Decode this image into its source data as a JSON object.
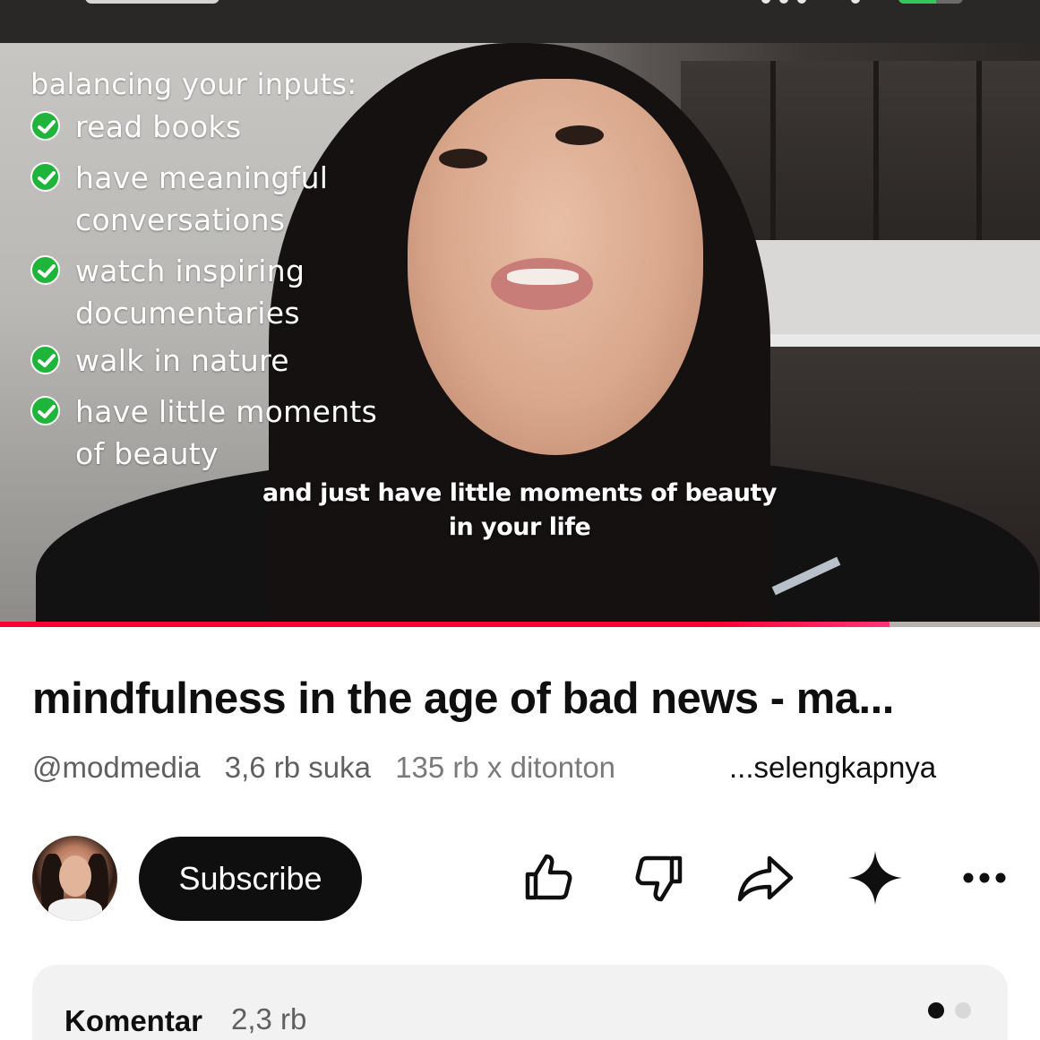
{
  "video": {
    "overlay_heading": "balancing your inputs:",
    "overlay_items": [
      [
        "read books"
      ],
      [
        "have meaningful",
        "conversations"
      ],
      [
        "watch inspiring",
        "documentaries"
      ],
      [
        "walk in nature"
      ],
      [
        "have little moments",
        "of beauty"
      ]
    ],
    "caption_line1": "and just have little moments of beauty",
    "caption_line2": "in your life",
    "progress_fraction": 0.855
  },
  "details": {
    "title": "mindfulness in the age of bad news - ma...",
    "handle": "@modmedia",
    "likes": "3,6 rb suka",
    "views": "135 rb x ditonton",
    "more_label": "...selengkapnya"
  },
  "actions": {
    "subscribe_label": "Subscribe",
    "icons": [
      "like-icon",
      "dislike-icon",
      "share-icon",
      "sparkle-icon",
      "more-icon"
    ]
  },
  "comments": {
    "label": "Komentar",
    "count": "2,3 rb"
  },
  "colors": {
    "progress_red": "#ff0033",
    "check_green": "#1fb53a",
    "button_black": "#0f0f0f",
    "secondary_text": "#606060",
    "battery_green": "#34c759"
  }
}
